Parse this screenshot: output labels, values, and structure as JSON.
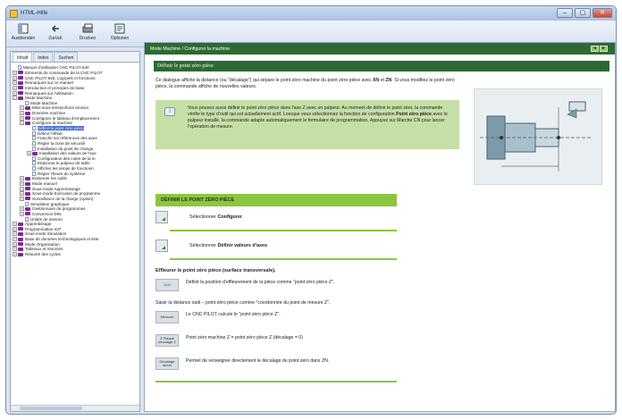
{
  "window": {
    "title": "HTML-Hilfe",
    "controls": [
      "–",
      "▢",
      "✕"
    ]
  },
  "toolbar": {
    "buttons": [
      {
        "label": "Ausblenden",
        "icon": "hide-icon"
      },
      {
        "label": "Zurück",
        "icon": "back-arrow-icon"
      },
      {
        "label": "Drucken",
        "icon": "printer-icon"
      },
      {
        "label": "Optionen",
        "icon": "options-icon"
      }
    ]
  },
  "nav": {
    "tabs": [
      "Inhalt",
      "Index",
      "Suchen"
    ],
    "tree": [
      {
        "label": "Manuel d'utilisation CNC PILOT 640",
        "level": 0,
        "kind": "page",
        "exp": ""
      },
      {
        "label": "Eléments de commande de la CNC PILOT",
        "level": 0,
        "kind": "book",
        "exp": "+"
      },
      {
        "label": "CNC PILOT 640, Logiciels et fonctions",
        "level": 0,
        "kind": "book",
        "exp": "+"
      },
      {
        "label": "Remarques sur ce manuel",
        "level": 0,
        "kind": "book",
        "exp": "+"
      },
      {
        "label": "Introduction et principes de base",
        "level": 0,
        "kind": "book",
        "exp": "+"
      },
      {
        "label": "Remarques sur l'utilisation",
        "level": 0,
        "kind": "book",
        "exp": "+"
      },
      {
        "label": "Mode Machine",
        "level": 0,
        "kind": "book",
        "exp": "–"
      },
      {
        "label": "Mode Machine",
        "level": 1,
        "kind": "page",
        "exp": ""
      },
      {
        "label": "Mise sous tension/hors tension",
        "level": 1,
        "kind": "book",
        "exp": "+"
      },
      {
        "label": "Données machine",
        "level": 1,
        "kind": "book",
        "exp": "+"
      },
      {
        "label": "Configurer le tableau d'emplacement",
        "level": 1,
        "kind": "book",
        "exp": "+"
      },
      {
        "label": "Configurer la machine",
        "level": 1,
        "kind": "book",
        "exp": "–"
      },
      {
        "label": "Définir le point zéro pièce",
        "level": 2,
        "kind": "page",
        "exp": "",
        "selected": true
      },
      {
        "label": "Définir l'offset",
        "level": 2,
        "kind": "page",
        "exp": ""
      },
      {
        "label": "Franchir les références des axes",
        "level": 2,
        "kind": "page",
        "exp": ""
      },
      {
        "label": "Régler la zone de sécurité",
        "level": 2,
        "kind": "page",
        "exp": ""
      },
      {
        "label": "Installation du point de change",
        "level": 2,
        "kind": "page",
        "exp": ""
      },
      {
        "label": "Installation des valeurs de l'axe",
        "level": 2,
        "kind": "book",
        "exp": "+"
      },
      {
        "label": "Configuration des cotes de la m",
        "level": 2,
        "kind": "page",
        "exp": ""
      },
      {
        "label": "Etalonner le palpeur de table",
        "level": 2,
        "kind": "page",
        "exp": ""
      },
      {
        "label": "Afficher les temps de fonctionn",
        "level": 2,
        "kind": "page",
        "exp": ""
      },
      {
        "label": "Régler l'heure du système",
        "level": 2,
        "kind": "page",
        "exp": ""
      },
      {
        "label": "Etalonner les outils",
        "level": 1,
        "kind": "book",
        "exp": "+"
      },
      {
        "label": "Mode manuel",
        "level": 1,
        "kind": "book",
        "exp": "+"
      },
      {
        "label": "Sous-mode Apprentissage",
        "level": 1,
        "kind": "book",
        "exp": "+"
      },
      {
        "label": "Sous-mode Exécution de programme",
        "level": 1,
        "kind": "book",
        "exp": "+"
      },
      {
        "label": "Surveillance de la charge (option)",
        "level": 1,
        "kind": "book",
        "exp": "+"
      },
      {
        "label": "Simulation graphique",
        "level": 1,
        "kind": "page",
        "exp": ""
      },
      {
        "label": "Gestionnaire de programmes",
        "level": 1,
        "kind": "book",
        "exp": "+"
      },
      {
        "label": "Conversion DIN",
        "level": 1,
        "kind": "book",
        "exp": "+"
      },
      {
        "label": "Unités de mesure",
        "level": 1,
        "kind": "page",
        "exp": ""
      },
      {
        "label": "Apprentissage",
        "level": 0,
        "kind": "book",
        "exp": "+"
      },
      {
        "label": "Programmation ICP",
        "level": 0,
        "kind": "book",
        "exp": "+"
      },
      {
        "label": "Sous-mode Simulation",
        "level": 0,
        "kind": "book",
        "exp": "+"
      },
      {
        "label": "Base de données technologiques et liste",
        "level": 0,
        "kind": "book",
        "exp": "+"
      },
      {
        "label": "Mode Organisation",
        "level": 0,
        "kind": "book",
        "exp": "+"
      },
      {
        "label": "Tableaux et résumés",
        "level": 0,
        "kind": "book",
        "exp": "+"
      },
      {
        "label": "Résumé des cycles",
        "level": 0,
        "kind": "book",
        "exp": "+"
      }
    ]
  },
  "content": {
    "breadcrumb": "Mode Machine / Configurer la machine",
    "header_buttons": [
      "◄",
      "►"
    ],
    "section_title": "Définir le point zéro pièce",
    "intro": {
      "text1": "Ce dialogue affiche la distance (ou \"décalage\") qui sépare le point zéro machine du point zéro pièce avec ",
      "bold1": "XN",
      "text2": " et ",
      "bold2": "ZN",
      "text3": ". Si vous modifiez le point zéro pièce, la commande affiche de nouvelles valeurs."
    },
    "note": {
      "icon_label": "i",
      "text1": "Vous pouvez aussi définir le point zéro pièce dans l'axe Z avec un palpeur. Au moment de définir le point zéro, la commande vérifie le type d'outil qui est actuellement actif. Lorsque vous sélectionnez la fonction de configuration ",
      "bold": "Point zéro pièce",
      "text2": " avec le palpeur installé, la commande adapte automatiquement le formulaire de programmation. Appuyez sur Marche CN pour lancer l'opération de mesure."
    },
    "procedure_title": "DÉFINIR LE POINT ZÉRO PIÈCE",
    "steps": [
      {
        "prefix": "Sélectionner ",
        "bold": "Configurer"
      },
      {
        "prefix": "Sélectionner ",
        "bold": "Définir valeurs d'axes"
      }
    ],
    "subheading": "Effleurer le point zéro pièce (surface transversale).",
    "softkeys": [
      {
        "key_lines": [
          "Z=0"
        ],
        "text": "Définit la position d'effleurement de la pièce comme \"point zéro pièce Z\"."
      },
      {
        "key_lines": [
          "Mesurer"
        ],
        "text": "Le CNC PILOT calcule le \"point zéro pièce Z\"."
      },
      {
        "key_lines": [
          "Z Plaque",
          "décalage Z"
        ],
        "text": "Point zéro machine Z = point zéro pièce Z (décalage = 0)"
      },
      {
        "key_lines": [
          "Décalage",
          "direct"
        ],
        "text": "Permet de renseigner directement le décalage du point zéro dans ZN."
      }
    ],
    "measure_text": "Saisir la distance outil – point zéro pièce comme \"coordonnée du point de mesure Z\"."
  },
  "colors": {
    "header_green": "#2c6a32",
    "accent_green": "#8cc63f",
    "note_green": "#c6dfa6",
    "tree_book": "#7b2c8f"
  }
}
